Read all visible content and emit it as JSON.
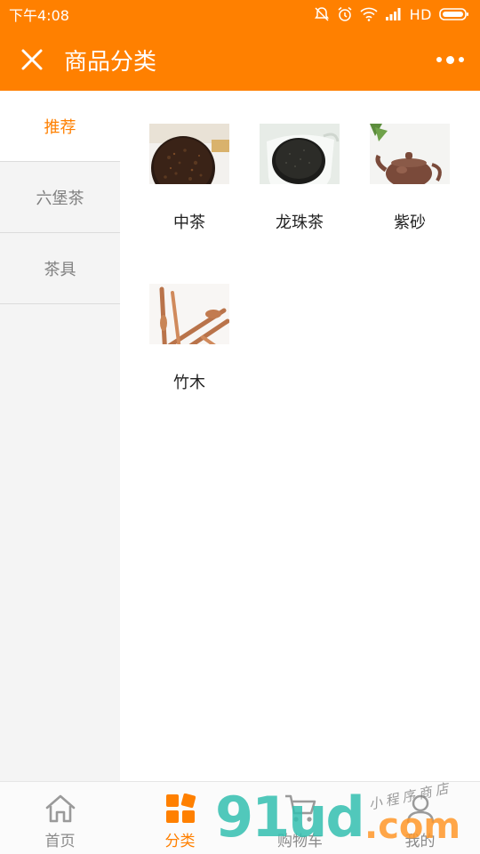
{
  "statusbar": {
    "time": "下午4:08",
    "network": "HD",
    "icons": [
      "mute-bell-icon",
      "alarm-icon",
      "wifi-icon",
      "signal-icon",
      "battery-icon"
    ]
  },
  "header": {
    "title": "商品分类",
    "close_icon": "close-icon",
    "more_icon": "more-dots-icon"
  },
  "sidebar": {
    "items": [
      {
        "label": "推荐",
        "active": true
      },
      {
        "label": "六堡茶",
        "active": false
      },
      {
        "label": "茶具",
        "active": false
      }
    ]
  },
  "categories": [
    {
      "label": "中茶",
      "image": "dark-tea-cake"
    },
    {
      "label": "龙珠茶",
      "image": "black-tea-leaves"
    },
    {
      "label": "紫砂",
      "image": "clay-teapot"
    },
    {
      "label": "竹木",
      "image": "bamboo-tea-tools"
    }
  ],
  "tabbar": {
    "tabs": [
      {
        "label": "首页",
        "icon": "home-icon",
        "active": false
      },
      {
        "label": "分类",
        "icon": "category-icon",
        "active": true
      },
      {
        "label": "购物车",
        "icon": "cart-icon",
        "active": false
      },
      {
        "label": "我的",
        "icon": "user-icon",
        "active": false
      }
    ]
  },
  "watermark": {
    "logo": "91ud",
    "suffix": ".com",
    "tagline": "小程序商店"
  },
  "colors": {
    "brand": "#ff8000",
    "sidebar_bg": "#f4f4f4",
    "inactive_text": "#808080"
  }
}
